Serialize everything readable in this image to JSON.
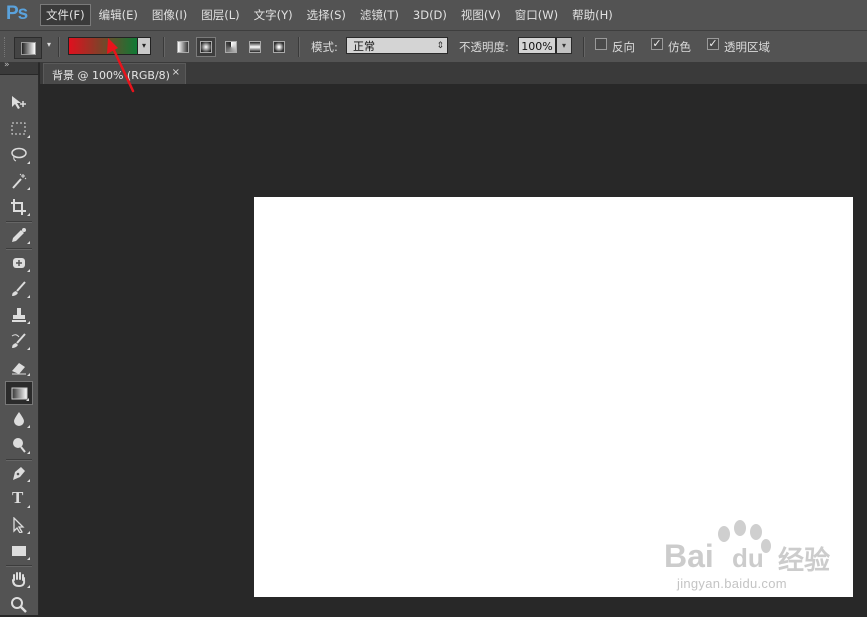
{
  "app": {
    "logo": "Ps"
  },
  "menu": {
    "items": [
      {
        "label": "文件(F)"
      },
      {
        "label": "编辑(E)"
      },
      {
        "label": "图像(I)"
      },
      {
        "label": "图层(L)"
      },
      {
        "label": "文字(Y)"
      },
      {
        "label": "选择(S)"
      },
      {
        "label": "滤镜(T)"
      },
      {
        "label": "3D(D)"
      },
      {
        "label": "视图(V)"
      },
      {
        "label": "窗口(W)"
      },
      {
        "label": "帮助(H)"
      }
    ]
  },
  "options": {
    "gradient_colors": [
      "#e0101e",
      "#0f7a35"
    ],
    "gradient_types": [
      "linear",
      "radial",
      "angle",
      "reflected",
      "diamond"
    ],
    "selected_gradient_type": "radial",
    "mode_label": "模式:",
    "mode_value": "正常",
    "opacity_label": "不透明度:",
    "opacity_value": "100%",
    "reverse_label": "反向",
    "reverse_checked": false,
    "dither_label": "仿色",
    "dither_checked": true,
    "transparency_label": "透明区域",
    "transparency_checked": true,
    "check_glyph": "✓",
    "dropdown_glyph": "▾"
  },
  "document": {
    "tab_title": "背景 @ 100% (RGB/8)",
    "close_glyph": "×",
    "canvas_color": "#ffffff"
  },
  "toolbox": {
    "selected": "gradient-tool",
    "tools": [
      "move-tool",
      "marquee-tool",
      "lasso-tool",
      "magic-wand-tool",
      "crop-tool",
      "eyedropper-tool",
      "healing-brush-tool",
      "brush-tool",
      "clone-stamp-tool",
      "history-brush-tool",
      "eraser-tool",
      "gradient-tool",
      "blur-tool",
      "dodge-tool",
      "pen-tool",
      "type-tool",
      "path-selection-tool",
      "rectangle-tool",
      "hand-tool",
      "zoom-tool"
    ],
    "type_glyph": "T",
    "collapse_glyph": "»"
  },
  "annotation": {
    "arrow_color": "#e8141c"
  },
  "watermark": {
    "logo": "Bai  du",
    "label": "经验",
    "url": "jingyan.baidu.com"
  }
}
